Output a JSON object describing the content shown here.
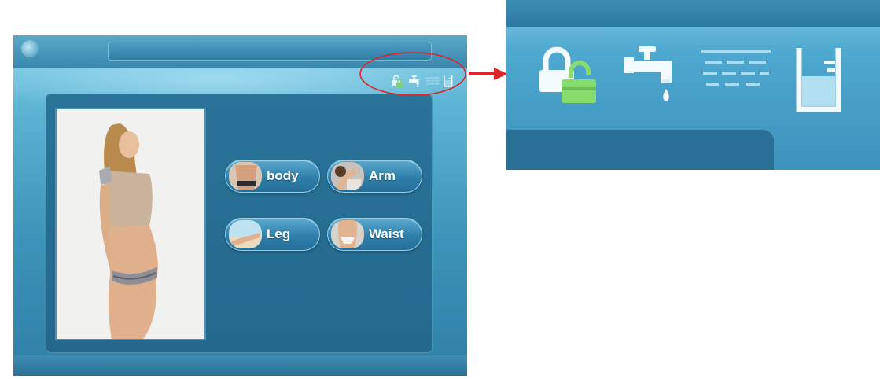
{
  "device_screen": {
    "status_icons": [
      "unlock-icon",
      "water-tap-icon",
      "water-flow-icon",
      "water-level-icon"
    ],
    "model_photo": "full-body-model-image",
    "body_areas": [
      {
        "key": "body",
        "label": "body",
        "icon": "torso-thumbnail"
      },
      {
        "key": "arm",
        "label": "Arm",
        "icon": "arm-thumbnail"
      },
      {
        "key": "leg",
        "label": "Leg",
        "icon": "leg-thumbnail"
      },
      {
        "key": "waist",
        "label": "Waist",
        "icon": "waist-thumbnail"
      }
    ]
  },
  "zoomed_callout": {
    "icons": [
      "unlock-icon",
      "water-tap-icon",
      "water-flow-icon",
      "water-level-icon"
    ]
  },
  "colors": {
    "panel": "#24688d",
    "button": "#2f7fab",
    "callout_ring": "#e0242b",
    "arrow": "#e0242b",
    "lock_green": "#7fd36a"
  }
}
